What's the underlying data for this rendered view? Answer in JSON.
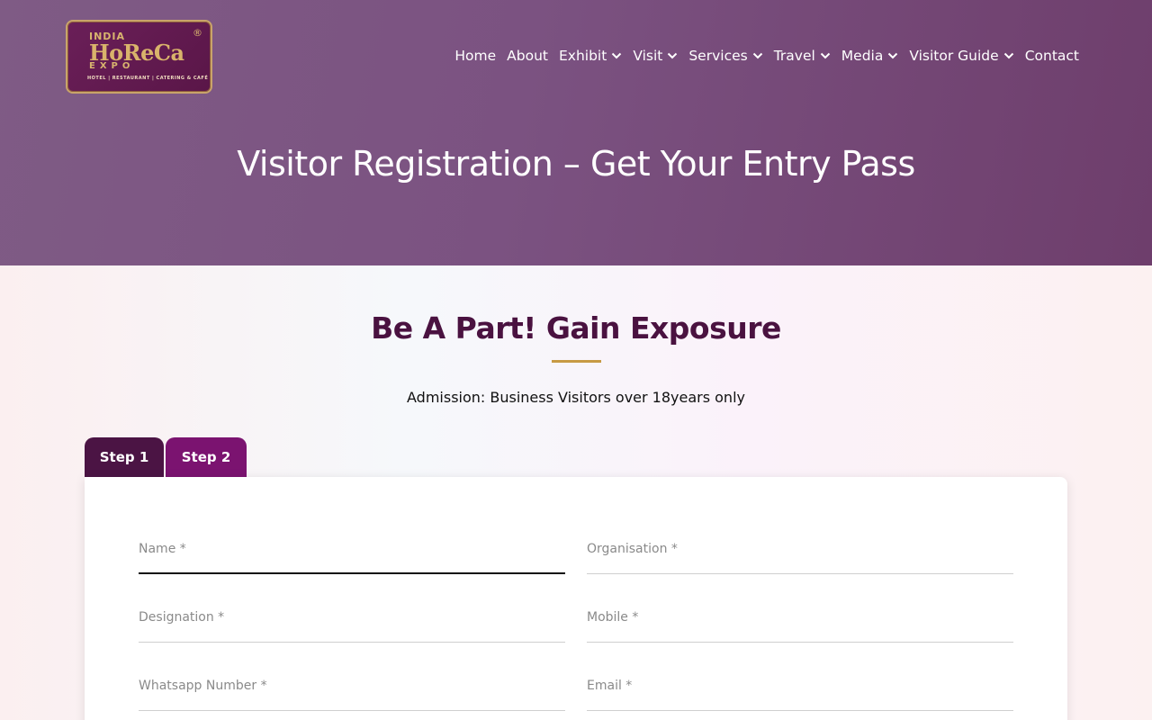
{
  "logo": {
    "top_word": "INDIA",
    "main_word": "HoReCa",
    "bottom_word": "EXPO",
    "registered_mark": "®",
    "tagline": "HOTEL | RESTAURANT | CATERING & CAFÉ",
    "colors": {
      "background": "#6a1f58",
      "gold": "#d9b36b"
    }
  },
  "nav": {
    "items": [
      {
        "label": "Home",
        "dropdown": false
      },
      {
        "label": "About",
        "dropdown": false
      },
      {
        "label": "Exhibit",
        "dropdown": true
      },
      {
        "label": "Visit",
        "dropdown": true
      },
      {
        "label": "Services",
        "dropdown": true
      },
      {
        "label": "Travel",
        "dropdown": true
      },
      {
        "label": "Media",
        "dropdown": true
      },
      {
        "label": "Visitor Guide",
        "dropdown": true
      },
      {
        "label": "Contact",
        "dropdown": false
      }
    ],
    "dropdown_icon": "chevron-down-icon"
  },
  "hero": {
    "title": "Visitor Registration – Get Your Entry Pass",
    "background_color": "#7b5281"
  },
  "section": {
    "title": "Be A Part! Gain Exposure",
    "underline_color": "#c79a44",
    "admission_text": "Admission: Business Visitors over 18years only"
  },
  "tabs": [
    {
      "label": "Step 1",
      "active": true,
      "color": "#4b1444"
    },
    {
      "label": "Step 2",
      "active": false,
      "color": "#7b1370"
    }
  ],
  "form": {
    "fields": {
      "name": {
        "label": "Name *",
        "value": ""
      },
      "organisation": {
        "label": "Organisation *",
        "value": ""
      },
      "designation": {
        "label": "Designation *",
        "value": ""
      },
      "mobile": {
        "label": "Mobile *",
        "value": ""
      },
      "whatsapp": {
        "label": "Whatsapp Number *",
        "value": ""
      },
      "email": {
        "label": "Email *",
        "value": ""
      }
    }
  }
}
